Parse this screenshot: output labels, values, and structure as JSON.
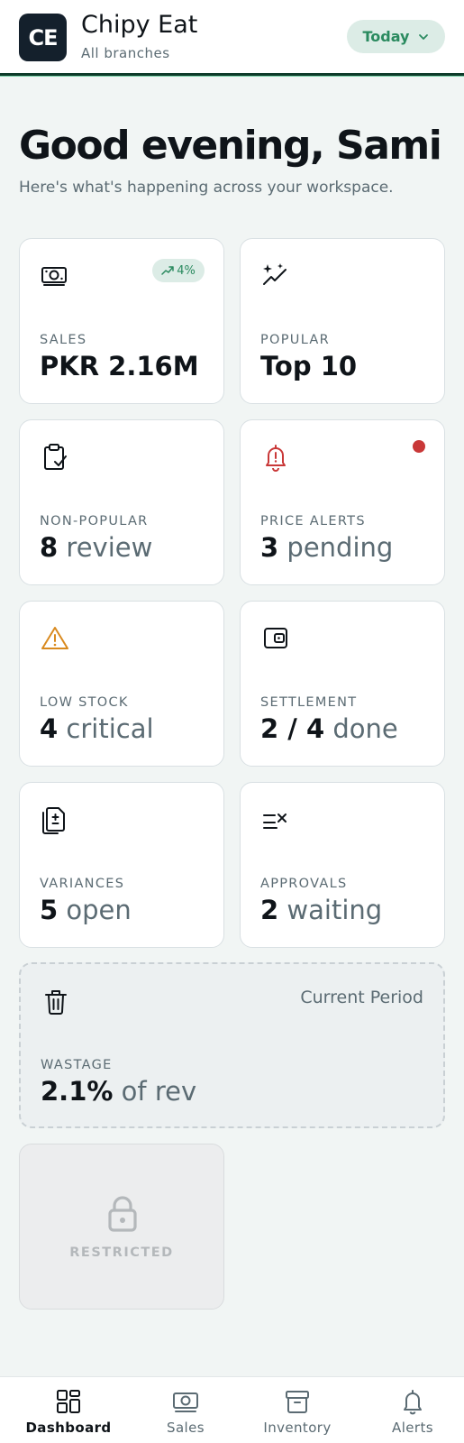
{
  "header": {
    "logo_text": "CE",
    "brand_name": "Chipy Eat",
    "brand_sub": "All branches",
    "period_label": "Today"
  },
  "greeting": {
    "title": "Good evening, Sami",
    "subtitle": "Here's what's happening across your workspace."
  },
  "cards": [
    {
      "icon": "money-icon",
      "label": "SALES",
      "strong": "PKR 2.16M",
      "soft": "",
      "badge": "4%"
    },
    {
      "icon": "sparkles-icon",
      "label": "POPULAR",
      "strong": "Top 10",
      "soft": ""
    },
    {
      "icon": "clipboard-check-icon",
      "label": "NON-POPULAR",
      "strong": "8",
      "soft": "review"
    },
    {
      "icon": "bell-alert-icon",
      "label": "PRICE ALERTS",
      "strong": "3",
      "soft": "pending"
    },
    {
      "icon": "warning-icon",
      "label": "LOW STOCK",
      "strong": "4",
      "soft": "critical"
    },
    {
      "icon": "wallet-icon",
      "label": "SETTLEMENT",
      "strong": "2 / 4",
      "soft": "done"
    },
    {
      "icon": "document-diff-icon",
      "label": "VARIANCES",
      "strong": "5",
      "soft": "open"
    },
    {
      "icon": "list-check-icon",
      "label": "APPROVALS",
      "strong": "2",
      "soft": "waiting"
    }
  ],
  "wastage": {
    "icon": "trash-icon",
    "period": "Current Period",
    "label": "WASTAGE",
    "strong": "2.1%",
    "soft": "of rev"
  },
  "restricted": {
    "icon": "lock-icon",
    "label": "RESTRICTED"
  },
  "nav": [
    {
      "icon": "dashboard-icon",
      "label": "Dashboard",
      "active": true
    },
    {
      "icon": "money-icon",
      "label": "Sales",
      "active": false
    },
    {
      "icon": "archive-icon",
      "label": "Inventory",
      "active": false
    },
    {
      "icon": "bell-icon",
      "label": "Alerts",
      "active": false
    }
  ],
  "colors": {
    "accent": "#2a8a5f",
    "accent_bg": "#dcece6",
    "alert_red": "#c93838",
    "warning_orange": "#d98a1f",
    "header_border": "#0e3b2a"
  }
}
